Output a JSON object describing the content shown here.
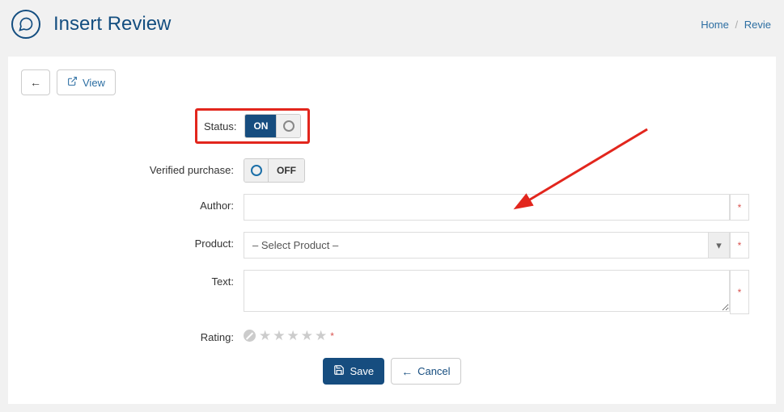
{
  "page": {
    "title": "Insert Review"
  },
  "breadcrumb": {
    "home": "Home",
    "reviews": "Revie"
  },
  "toolbar": {
    "view": "View"
  },
  "form": {
    "status": {
      "label": "Status:",
      "value": "ON"
    },
    "verified": {
      "label": "Verified purchase:",
      "value": "OFF"
    },
    "author": {
      "label": "Author:",
      "value": ""
    },
    "product": {
      "label": "Product:",
      "placeholder": "– Select Product –",
      "value": ""
    },
    "text": {
      "label": "Text:",
      "value": ""
    },
    "rating": {
      "label": "Rating:",
      "value": 0,
      "max": 5
    }
  },
  "footer": {
    "save": "Save",
    "cancel": "Cancel"
  },
  "required_marker": "*"
}
